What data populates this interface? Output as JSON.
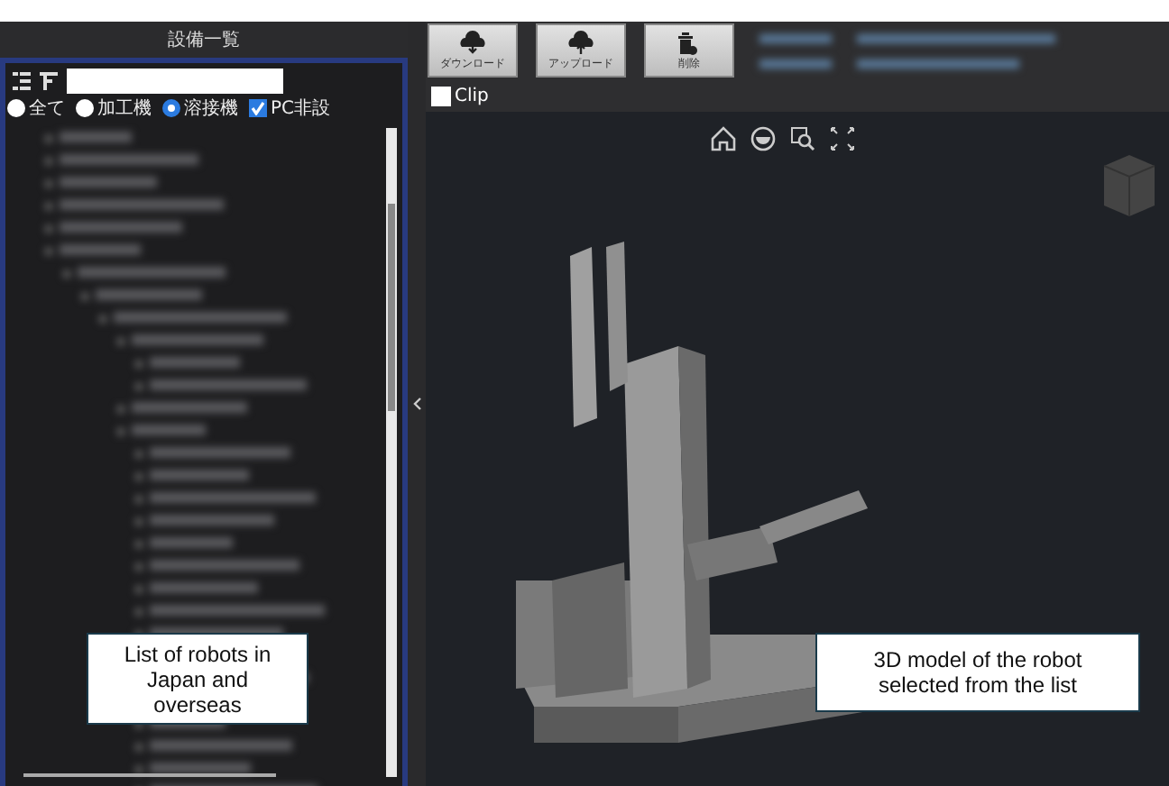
{
  "equipment_panel": {
    "title": "設備一覧",
    "search": {
      "kind": "text"
    },
    "filters": [
      {
        "label": "全て",
        "kind": "radio",
        "selected": false
      },
      {
        "label": "加工機",
        "kind": "radio",
        "selected": false
      },
      {
        "label": "溶接機",
        "kind": "radio",
        "selected": true
      },
      {
        "label": "PC非設",
        "kind": "checkbox",
        "checked": true
      }
    ]
  },
  "toolbar": {
    "buttons": [
      {
        "label": "ダウンロード",
        "kind": "download"
      },
      {
        "label": "アップロード",
        "kind": "upload"
      },
      {
        "label": "削除",
        "kind": "delete"
      }
    ]
  },
  "clip": {
    "label": "Clip",
    "checked": false
  },
  "callouts": [
    {
      "text": "List of robots in Japan and overseas",
      "kind": "left"
    },
    {
      "text": "3D model of the robot selected from the list",
      "kind": "right"
    }
  ]
}
